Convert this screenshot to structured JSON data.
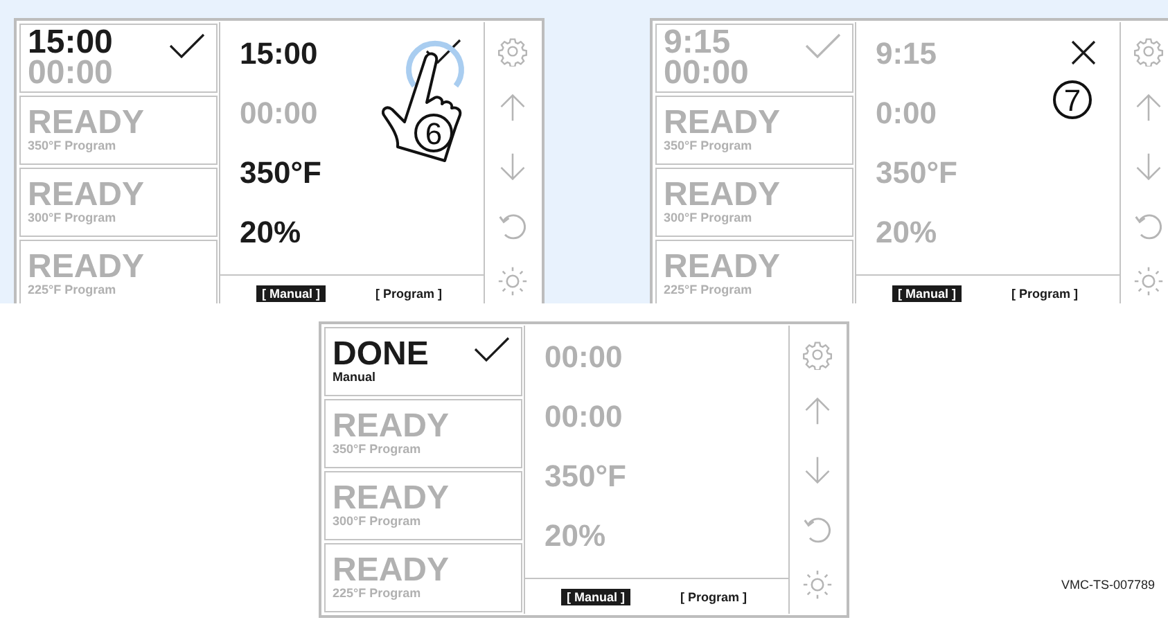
{
  "screens": [
    {
      "cards": [
        {
          "kind": "timer",
          "title": "15:00",
          "subtitle": "00:00",
          "dimmed": false,
          "subtitle_dimmed": true,
          "check_active": true
        },
        {
          "kind": "status",
          "title": "READY",
          "subtitle": "350°F Program",
          "dimmed": true
        },
        {
          "kind": "status",
          "title": "READY",
          "subtitle": "300°F Program",
          "dimmed": true
        },
        {
          "kind": "status",
          "title": "READY",
          "subtitle": "225°F Program",
          "dimmed": true
        }
      ],
      "main": {
        "lines": [
          {
            "text": "15:00",
            "dimmed": false
          },
          {
            "text": "00:00",
            "dimmed": true
          },
          {
            "text": "350°F",
            "dimmed": false
          },
          {
            "text": "20%",
            "dimmed": false
          }
        ],
        "action": {
          "kind": "check"
        },
        "callout": {
          "number": "6",
          "touch": true
        }
      },
      "tabs": [
        {
          "label": "[ Manual ]",
          "selected": true
        },
        {
          "label": "[ Program ]",
          "selected": false
        }
      ]
    },
    {
      "cards": [
        {
          "kind": "timer",
          "title": "9:15",
          "subtitle": "00:00",
          "dimmed": true,
          "check_active": false
        },
        {
          "kind": "status",
          "title": "READY",
          "subtitle": "350°F Program",
          "dimmed": true
        },
        {
          "kind": "status",
          "title": "READY",
          "subtitle": "300°F Program",
          "dimmed": true
        },
        {
          "kind": "status",
          "title": "READY",
          "subtitle": "225°F Program",
          "dimmed": true
        }
      ],
      "main": {
        "lines": [
          {
            "text": "9:15",
            "dimmed": true
          },
          {
            "text": "0:00",
            "dimmed": true
          },
          {
            "text": "350°F",
            "dimmed": true
          },
          {
            "text": "20%",
            "dimmed": true
          }
        ],
        "action": {
          "kind": "cross"
        },
        "callout": {
          "number": "7",
          "touch": false
        }
      },
      "tabs": [
        {
          "label": "[ Manual ]",
          "selected": true
        },
        {
          "label": "[ Program ]",
          "selected": false
        }
      ]
    },
    {
      "cards": [
        {
          "kind": "status",
          "title": "DONE",
          "subtitle": "Manual",
          "dimmed": false,
          "check_active": true
        },
        {
          "kind": "status",
          "title": "READY",
          "subtitle": "350°F Program",
          "dimmed": true
        },
        {
          "kind": "status",
          "title": "READY",
          "subtitle": "300°F Program",
          "dimmed": true
        },
        {
          "kind": "status",
          "title": "READY",
          "subtitle": "225°F Program",
          "dimmed": true
        }
      ],
      "main": {
        "lines": [
          {
            "text": "00:00",
            "dimmed": true
          },
          {
            "text": "00:00",
            "dimmed": true
          },
          {
            "text": "350°F",
            "dimmed": true
          },
          {
            "text": "20%",
            "dimmed": true
          }
        ]
      },
      "tabs": [
        {
          "label": "[ Manual ]",
          "selected": true
        },
        {
          "label": "[ Program ]",
          "selected": false
        }
      ]
    }
  ],
  "figure_id": "VMC-TS-007789"
}
